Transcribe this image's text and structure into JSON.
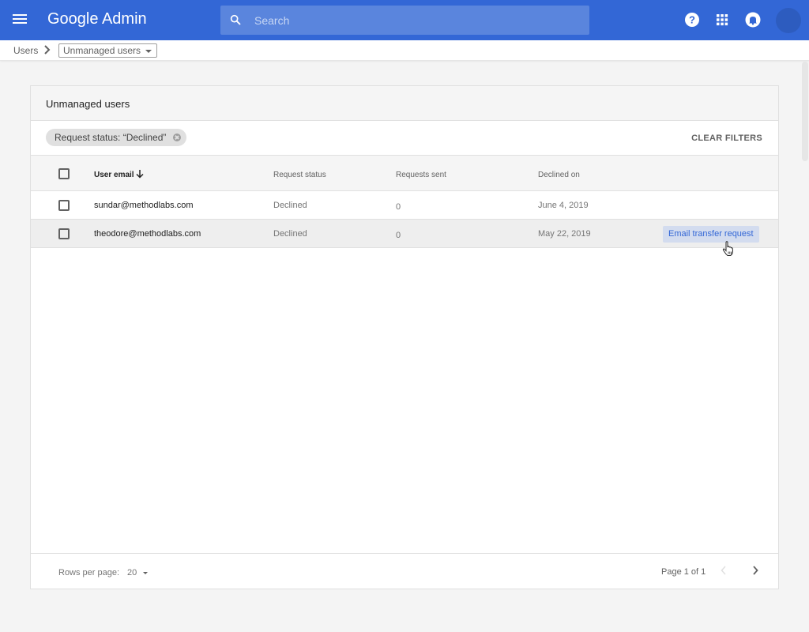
{
  "header": {
    "app_title": "Google Admin",
    "search_placeholder": "Search",
    "icons": [
      "menu-icon",
      "search-icon",
      "help-icon",
      "apps-icon",
      "notifications-icon",
      "account-avatar"
    ]
  },
  "breadcrumb": {
    "root": "Users",
    "current": "Unmanaged users"
  },
  "card": {
    "title": "Unmanaged users",
    "filter_chip": "Request status: “Declined”",
    "clear_filters": "CLEAR FILTERS"
  },
  "table": {
    "columns": [
      "User email",
      "Request status",
      "Requests sent",
      "Declined on"
    ],
    "rows": [
      {
        "email": "sundar@methodlabs.com",
        "status": "Declined",
        "sent": "0",
        "date": "June 4, 2019"
      },
      {
        "email": "theodore@methodlabs.com",
        "status": "Declined",
        "sent": "0",
        "date": "May 22, 2019",
        "action": "Email transfer request"
      }
    ]
  },
  "footer": {
    "rows_per_page_label": "Rows per page:",
    "rows_per_page_value": "20",
    "page_label": "Page 1 of 1"
  },
  "colors": {
    "brand": "#3367d6",
    "search_bg": "#5a85dd",
    "action_bg": "#d3dcef"
  }
}
